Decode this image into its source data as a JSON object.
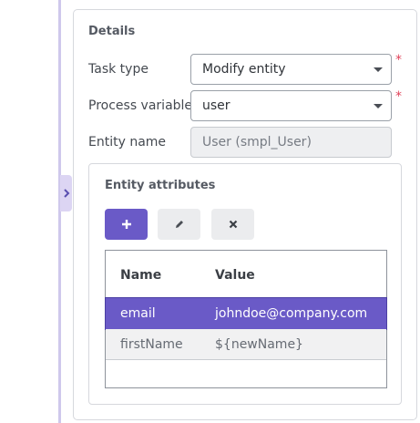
{
  "details": {
    "title": "Details",
    "task_type": {
      "label": "Task type",
      "value": "Modify entity",
      "required_mark": "*"
    },
    "process_variable": {
      "label": "Process variable",
      "value": "user",
      "required_mark": "*"
    },
    "entity_name": {
      "label": "Entity name",
      "value": "User (smpl_User)"
    }
  },
  "attributes": {
    "title": "Entity attributes",
    "toolbar": {
      "add_icon": "plus-icon",
      "edit_icon": "pencil-icon",
      "remove_icon": "close-icon"
    },
    "columns": [
      "Name",
      "Value"
    ],
    "rows": [
      {
        "name": "email",
        "value": "johndoe@company.com",
        "selected": true
      },
      {
        "name": "firstName",
        "value": "${newName}",
        "selected": false
      }
    ]
  },
  "colors": {
    "accent": "#6a5ac7",
    "required": "#e0435a",
    "rail": "#cfc8ec"
  }
}
